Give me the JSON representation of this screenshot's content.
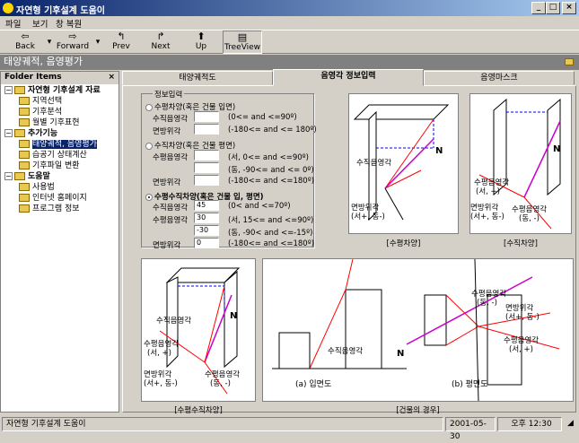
{
  "window": {
    "title": "자연형 기후설계 도움이"
  },
  "menu": [
    "파일",
    "보기",
    "창 복원"
  ],
  "toolbar": {
    "back": "Back",
    "forward": "Forward",
    "prev": "Prev",
    "next": "Next",
    "up": "Up",
    "treeview": "TreeView"
  },
  "address": "태양궤적, 음영평가",
  "folder": {
    "header": "Folder Items",
    "items": [
      {
        "label": "자연형 기후설계 자료"
      },
      {
        "label": "지역선택"
      },
      {
        "label": "기후분석"
      },
      {
        "label": "월별 기후표현"
      },
      {
        "label": "추가기능"
      },
      {
        "label": "태양궤적, 음영평가"
      },
      {
        "label": "습공기 상태계산"
      },
      {
        "label": "기후파일 변환"
      },
      {
        "label": "도움말"
      },
      {
        "label": "사용법"
      },
      {
        "label": "인터넷 홈페이지"
      },
      {
        "label": "프로그램 정보"
      }
    ]
  },
  "tabs": [
    "태양궤적도",
    "음영각 정보입력",
    "음영마스크"
  ],
  "form": {
    "group_title": "정보입력",
    "opt1": "수평차양(혹은 건물 입면)",
    "opt2": "수직차양(혹은 건물 평면)",
    "opt3": "수평수직차양(혹은 건물 입, 평면)",
    "l_vert": "수직음영각",
    "l_az": "면방위각",
    "l_horz": "수평음영각",
    "r1_vert": "(0<= and <=90º)",
    "r1_az": "(-180<= and <= 180º)",
    "r2_h1": "(서, 0<= and <=90º)",
    "r2_h2": "(동, -90<= and <= 0º)",
    "r2_az": "(-180<= and <=180º)",
    "r3_vert": "(0< and <=70º)",
    "r3_h1": "(서, 15<= and <=90º)",
    "r3_h2": "(동, -90< and <=-15º)",
    "r3_az": "(-180<= and <=180º)",
    "v3_vert": "45",
    "v3_h1": "30",
    "v3_h2": "-30",
    "v3_az": "0"
  },
  "figs": {
    "f1": "[수평차양]",
    "f2": "[수직차양]",
    "f3": "[수평수직차양]",
    "f4": "[건물의 경우]",
    "n": "N",
    "vert": "수직음영각",
    "az": "면방위각",
    "az_sub": "(서+, 동-)",
    "horz": "수평음영각",
    "w_plus": "(서, +)",
    "e_minus": "(동, -)",
    "elev": "(a) 입면도",
    "plan": "(b) 평면도"
  },
  "status": {
    "text": "자연형 기후설계 도움이",
    "date": "2001-05-30",
    "time": "오후 12:30"
  },
  "colors": {
    "title_start": "#0a246a",
    "title_end": "#a6caf0",
    "selected": "#0a246a",
    "arrow": "#cc00cc",
    "shade_line": "#ff0000",
    "dash": "#0000ff"
  }
}
